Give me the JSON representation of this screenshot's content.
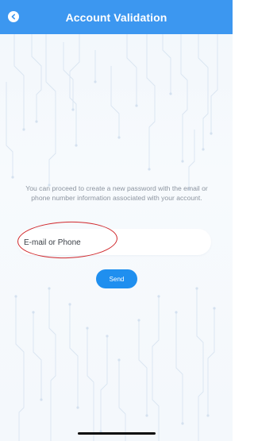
{
  "header": {
    "title": "Account Validation",
    "back_icon": "arrow-left-circle-icon",
    "background_color": "#3c97f0"
  },
  "main": {
    "info_text": "You can proceed to create a new password with the email or phone number information associated with your account.",
    "contact_input": {
      "placeholder": "E-mail or Phone",
      "value": ""
    },
    "send_button": {
      "label": "Send",
      "color": "#1f8fef"
    },
    "annotation_color": "#d0282c"
  }
}
